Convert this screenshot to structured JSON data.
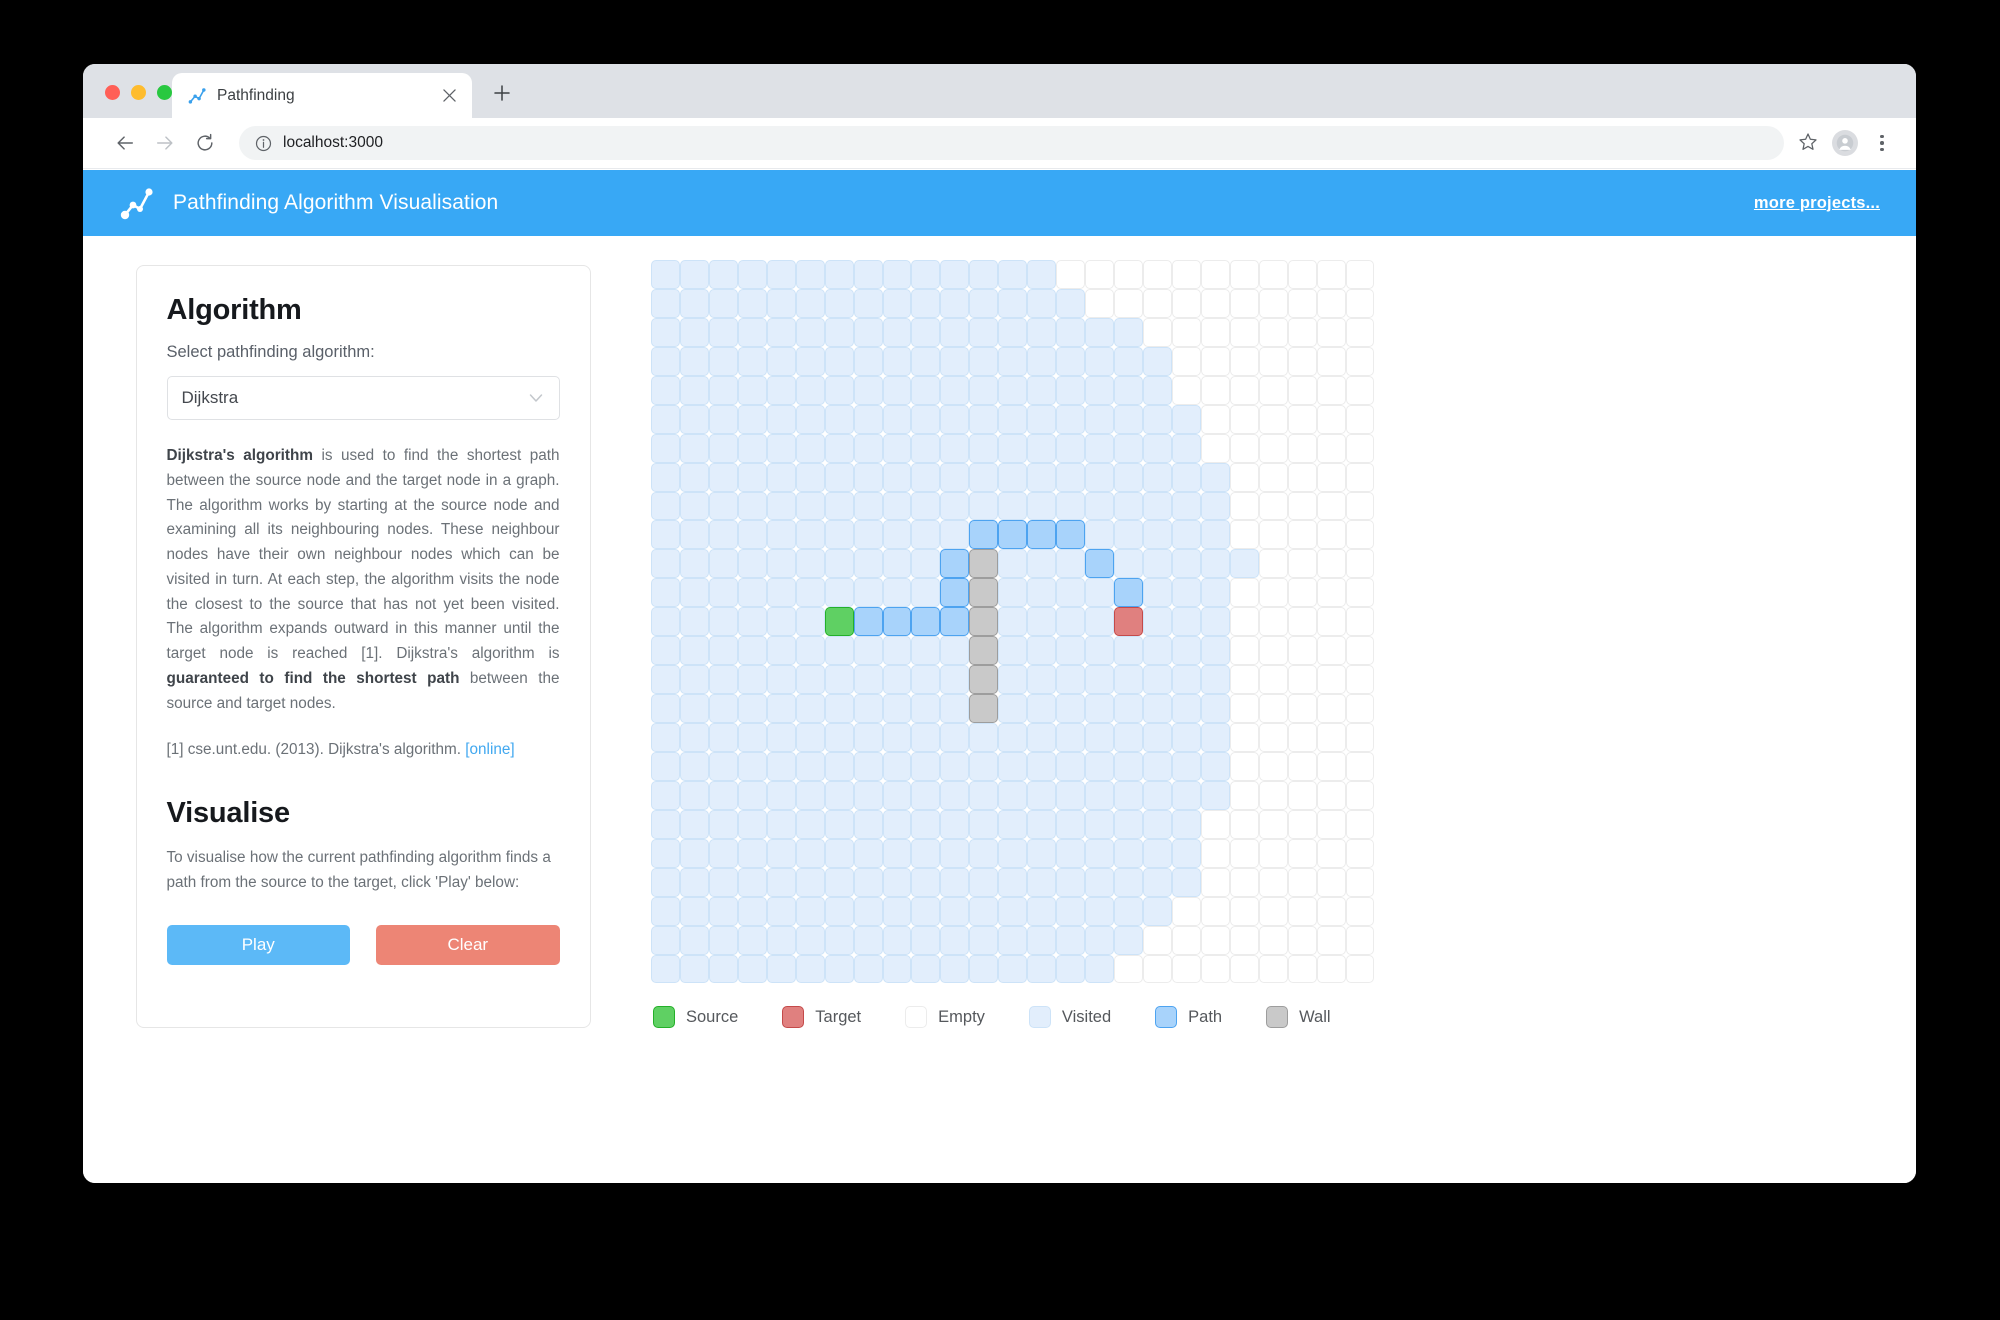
{
  "browser": {
    "tab": {
      "title": "Pathfinding",
      "favicon_icon": "line-chart-icon",
      "close_icon": "close-icon"
    },
    "new_tab_label": "+",
    "nav": {
      "back_icon": "arrow-left-icon",
      "forward_icon": "arrow-right-icon",
      "reload_icon": "reload-icon",
      "info_icon": "info-circle-icon",
      "url": "localhost:3000",
      "star_icon": "star-icon",
      "avatar_icon": "avatar-icon",
      "menu_icon": "three-dots-vertical-icon"
    }
  },
  "header": {
    "logo_icon": "path-graph-icon",
    "title": "Pathfinding Algorithm Visualisation",
    "link_label": "more projects...",
    "accent_color": "#38a8f5"
  },
  "algorithm_card": {
    "heading": "Algorithm",
    "select_label": "Select pathfinding algorithm:",
    "selected_option": "Dijkstra",
    "caret_icon": "chevron-down-icon",
    "options": [
      "Dijkstra"
    ],
    "description_bold_1": "Dijkstra's algorithm",
    "description_part_1": " is used to find the shortest path between the source node and the target node in a graph. The algorithm works by starting at the source node and examining all its neighbouring nodes. These neighbour nodes have their own neighbour nodes which can be visited in turn. At each step, the algorithm visits the node the closest to the source that has not yet been visited. The algorithm expands outward in this manner until the target node is reached [1]. Dijkstra's algorithm is ",
    "description_bold_2": "guaranteed to find the shortest path",
    "description_part_2": " between the source and target nodes.",
    "citation_text": "[1] cse.unt.edu. (2013). Dijkstra's algorithm. ",
    "citation_link": "[online]"
  },
  "visualise_card": {
    "heading": "Visualise",
    "text": "To visualise how the current pathfinding algorithm finds a path from the source to the target, click 'Play' below:",
    "play_label": "Play",
    "clear_label": "Clear",
    "play_color": "#5cb9f7",
    "clear_color": "#ed8575"
  },
  "legend": {
    "items": [
      {
        "label": "Source",
        "color": "#5fd063",
        "border": "#24b029"
      },
      {
        "label": "Target",
        "color": "#e0807f",
        "border": "#c44a4a"
      },
      {
        "label": "Empty",
        "color": "#ffffff",
        "border": "#ececec"
      },
      {
        "label": "Visited",
        "color": "#e2eefc",
        "border": "#cde3f8"
      },
      {
        "label": "Path",
        "color": "#a8d3fb",
        "border": "#4da3f0"
      },
      {
        "label": "Wall",
        "color": "#c9c9c9",
        "border": "#9d9d9d"
      }
    ]
  },
  "grid": {
    "cols": 25,
    "rows": 25,
    "source": {
      "col": 6,
      "row": 12
    },
    "target": {
      "col": 16,
      "row": 12
    },
    "walls": [
      {
        "col": 11,
        "row": 10
      },
      {
        "col": 11,
        "row": 11
      },
      {
        "col": 11,
        "row": 12
      },
      {
        "col": 11,
        "row": 13
      },
      {
        "col": 11,
        "row": 14
      },
      {
        "col": 11,
        "row": 15
      }
    ],
    "path": [
      {
        "col": 7,
        "row": 12
      },
      {
        "col": 8,
        "row": 12
      },
      {
        "col": 9,
        "row": 12
      },
      {
        "col": 10,
        "row": 12
      },
      {
        "col": 10,
        "row": 11
      },
      {
        "col": 10,
        "row": 10
      },
      {
        "col": 11,
        "row": 9
      },
      {
        "col": 12,
        "row": 9
      },
      {
        "col": 13,
        "row": 9
      },
      {
        "col": 14,
        "row": 9
      },
      {
        "col": 15,
        "row": 10
      },
      {
        "col": 16,
        "row": 11
      }
    ],
    "visited_row_extents": [
      {
        "row": 0,
        "max_col": 13
      },
      {
        "row": 1,
        "max_col": 14
      },
      {
        "row": 2,
        "max_col": 16
      },
      {
        "row": 3,
        "max_col": 17
      },
      {
        "row": 4,
        "max_col": 17
      },
      {
        "row": 5,
        "max_col": 18
      },
      {
        "row": 6,
        "max_col": 18
      },
      {
        "row": 7,
        "max_col": 19
      },
      {
        "row": 8,
        "max_col": 19
      },
      {
        "row": 9,
        "max_col": 19
      },
      {
        "row": 10,
        "max_col": 20
      },
      {
        "row": 11,
        "max_col": 19
      },
      {
        "row": 12,
        "max_col": 19
      },
      {
        "row": 13,
        "max_col": 19
      },
      {
        "row": 14,
        "max_col": 19
      },
      {
        "row": 15,
        "max_col": 19
      },
      {
        "row": 16,
        "max_col": 19
      },
      {
        "row": 17,
        "max_col": 19
      },
      {
        "row": 18,
        "max_col": 19
      },
      {
        "row": 19,
        "max_col": 18
      },
      {
        "row": 20,
        "max_col": 18
      },
      {
        "row": 21,
        "max_col": 18
      },
      {
        "row": 22,
        "max_col": 17
      },
      {
        "row": 23,
        "max_col": 16
      },
      {
        "row": 24,
        "max_col": 15
      }
    ]
  }
}
